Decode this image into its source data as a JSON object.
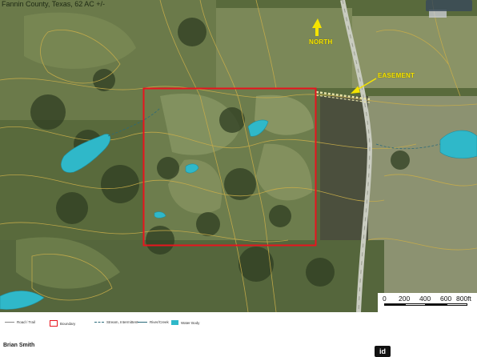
{
  "header": {
    "title": "Fannin County, Texas, 62 AC +/-"
  },
  "labels": {
    "north": "NORTH",
    "easement": "EASEMENT"
  },
  "scale_bar": {
    "ticks": [
      "0",
      "200",
      "400",
      "600",
      "800ft"
    ]
  },
  "legend": {
    "items": [
      {
        "label": "Road / Trail",
        "icon": "road-line"
      },
      {
        "label": "Boundary",
        "icon": "boundary-polygon"
      },
      {
        "label": "Stream, Intermittent",
        "icon": "stream-line"
      },
      {
        "label": "River/Creek",
        "icon": "river-line"
      },
      {
        "label": "Water Body",
        "icon": "water-polygon"
      }
    ]
  },
  "footer": {
    "agent_name": "Brian Smith",
    "badge": "id"
  },
  "colors": {
    "boundary": "#e8141e",
    "water": "#2fb8c9",
    "contour": "#c8ad4a",
    "annotation": "#f5e400",
    "road": "#d8d8d0"
  }
}
